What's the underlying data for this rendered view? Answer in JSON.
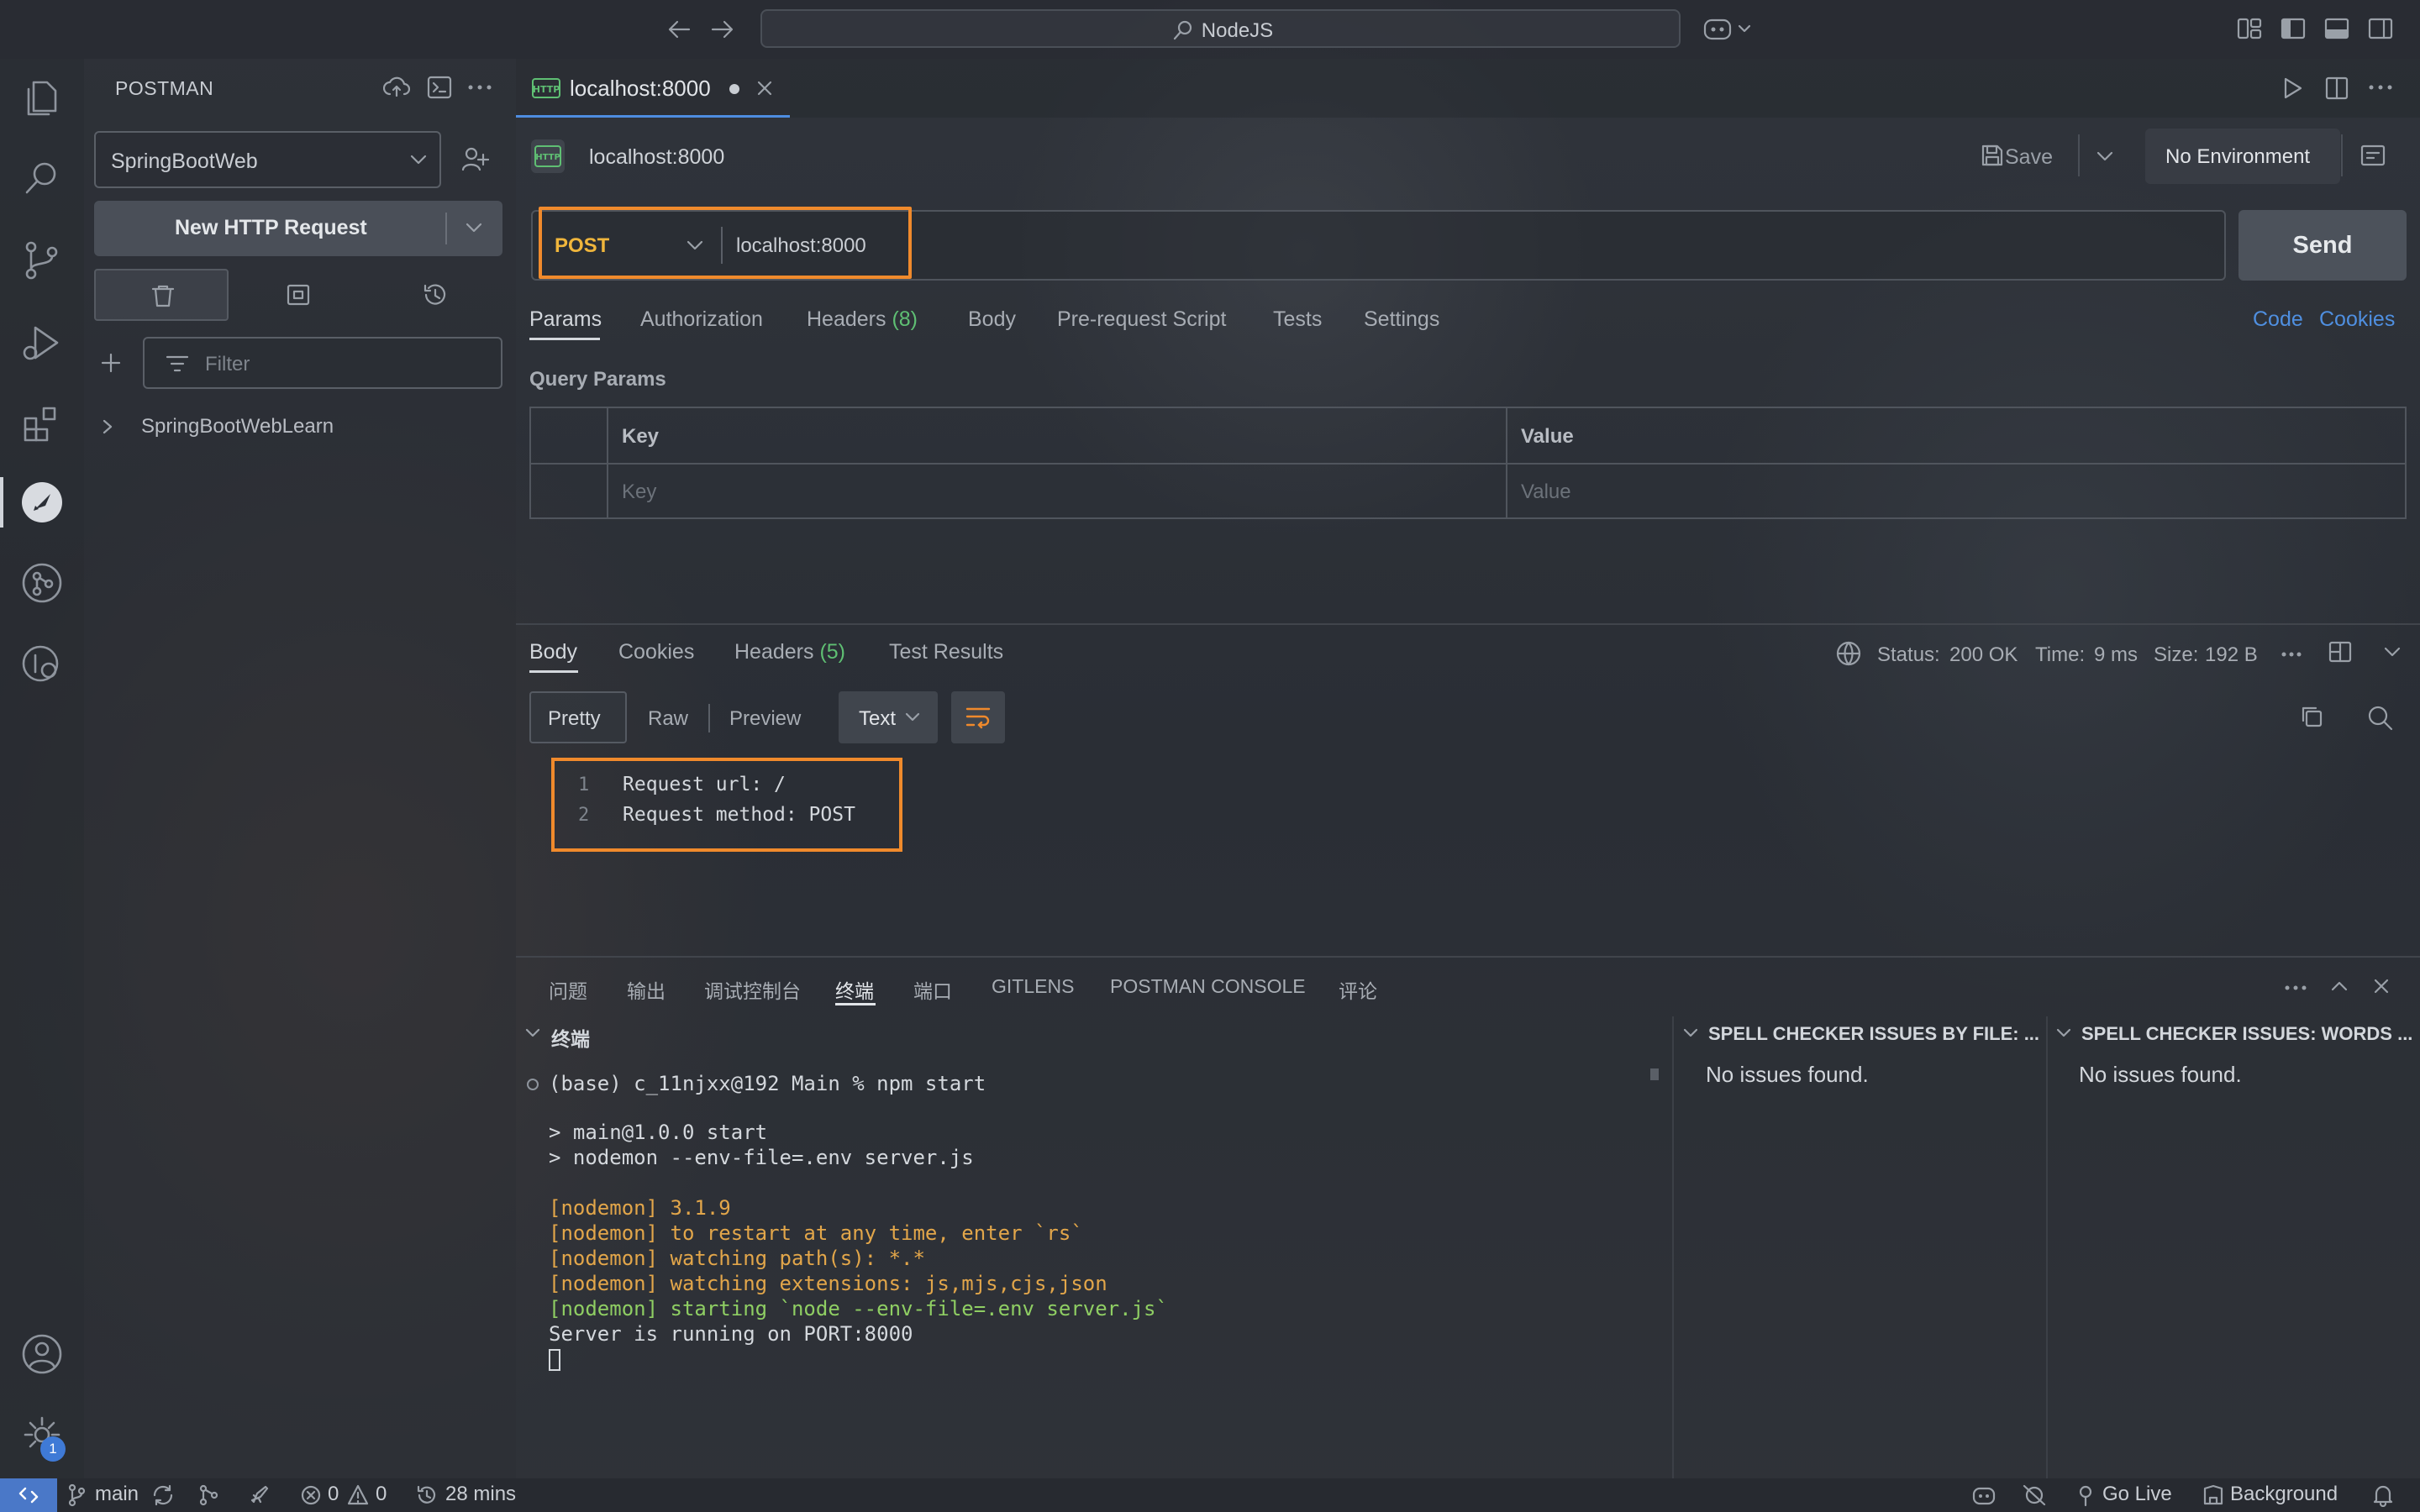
{
  "titlebar": {
    "search_label": "NodeJS"
  },
  "sidebar": {
    "title": "POSTMAN",
    "workspace": "SpringBootWeb",
    "new_request": "New HTTP Request",
    "filter_placeholder": "Filter",
    "collection": "SpringBootWebLearn"
  },
  "activity": {
    "badge_count": "1"
  },
  "editor_tab": {
    "label": "localhost:8000"
  },
  "request": {
    "title": "localhost:8000",
    "save": "Save",
    "environment": "No Environment",
    "method": "POST",
    "url": "localhost:8000",
    "send": "Send",
    "tabs": {
      "params": "Params",
      "authorization": "Authorization",
      "headers": "Headers",
      "headers_count": "(8)",
      "body": "Body",
      "pre_request": "Pre-request Script",
      "tests": "Tests",
      "settings": "Settings"
    },
    "code_link": "Code",
    "cookies_link": "Cookies",
    "query_params_title": "Query Params",
    "table": {
      "key_header": "Key",
      "value_header": "Value",
      "key_placeholder": "Key",
      "value_placeholder": "Value"
    }
  },
  "response": {
    "tabs": {
      "body": "Body",
      "cookies": "Cookies",
      "headers": "Headers",
      "headers_count": "(5)",
      "test_results": "Test Results"
    },
    "status_label": "Status:",
    "status_value": "200 OK",
    "time_label": "Time:",
    "time_value": "9 ms",
    "size_label": "Size:",
    "size_value": "192 B",
    "formats": {
      "pretty": "Pretty",
      "raw": "Raw",
      "preview": "Preview",
      "text": "Text"
    },
    "lines": [
      {
        "num": "1",
        "text": "Request url: /"
      },
      {
        "num": "2",
        "text": "Request method: POST"
      }
    ]
  },
  "panel": {
    "tabs": [
      "问题",
      "输出",
      "调试控制台",
      "终端",
      "端口",
      "GITLENS",
      "POSTMAN CONSOLE",
      "评论"
    ],
    "terminal_title": "终端",
    "terminal": [
      "(base) c_11njxx@192 Main % npm start",
      "> main@1.0.0 start",
      "> nodemon --env-file=.env server.js",
      "[nodemon] 3.1.9",
      "[nodemon] to restart at any time, enter `rs`",
      "[nodemon] watching path(s): *.*",
      "[nodemon] watching extensions: js,mjs,cjs,json",
      "[nodemon] starting `node --env-file=.env server.js`",
      "Server is running on PORT:8000"
    ],
    "spell_file_title": "SPELL CHECKER ISSUES BY FILE: ...",
    "spell_file_body": "No issues found.",
    "spell_words_title": "SPELL CHECKER ISSUES: WORDS ...",
    "spell_words_body": "No issues found."
  },
  "statusbar": {
    "branch": "main",
    "errors": "0",
    "warnings": "0",
    "time": "28 mins",
    "go_live": "Go Live",
    "background": "Background"
  }
}
